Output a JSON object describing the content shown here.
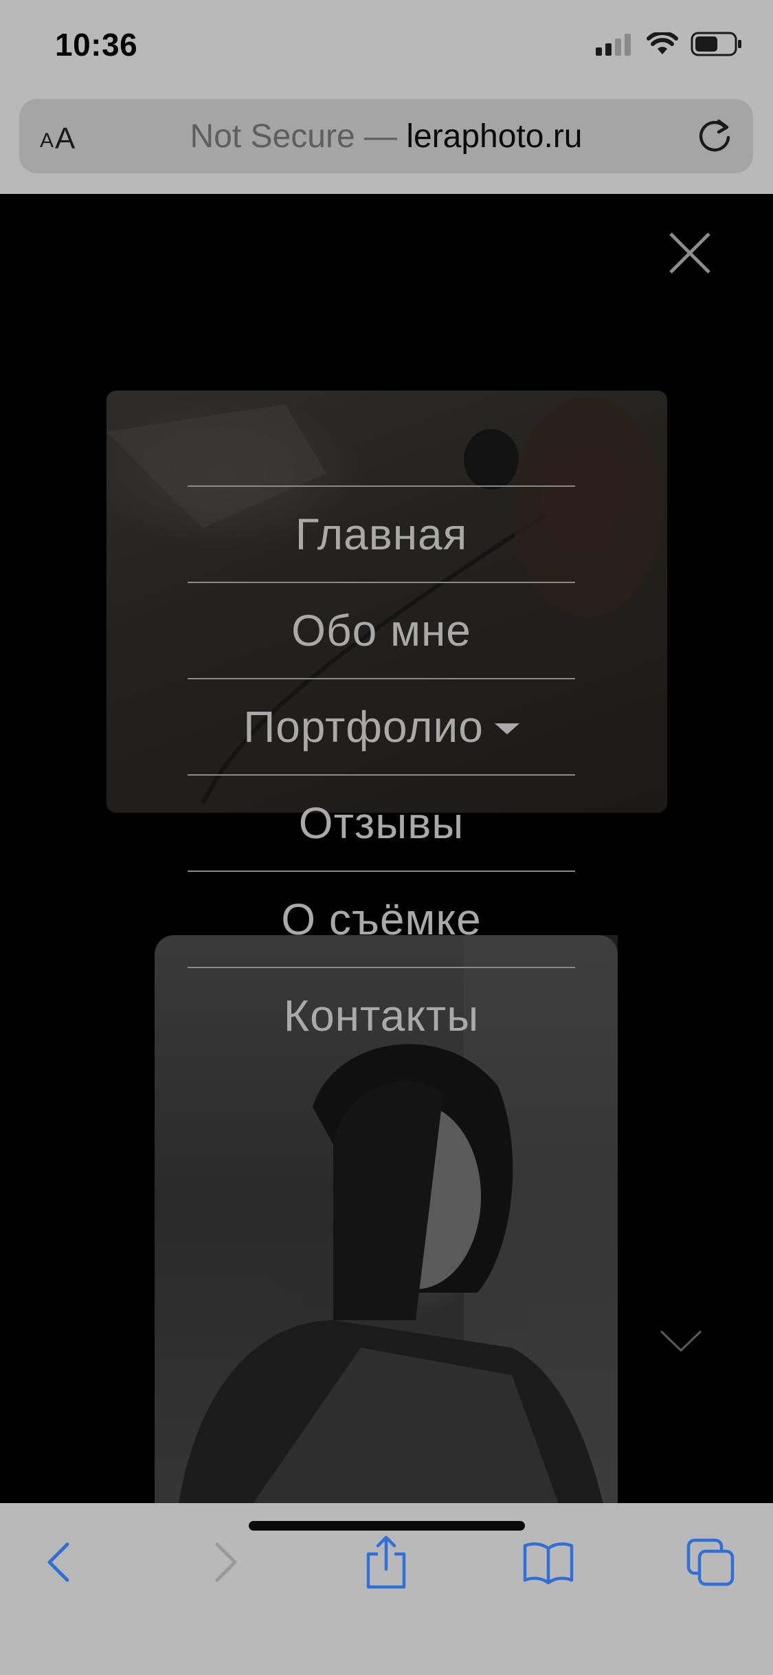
{
  "status_bar": {
    "time": "10:36",
    "icons": [
      "cellular-signal-icon",
      "wifi-icon",
      "battery-icon"
    ],
    "battery_level": 0.6
  },
  "address_bar": {
    "text_size_small": "A",
    "text_size_big": "A",
    "security_label": "Not Secure — ",
    "domain": "leraphoto.ru",
    "reload_icon": "reload-icon"
  },
  "page": {
    "close_icon": "close-icon",
    "scroll_icon": "chevron-down-icon",
    "menu": [
      {
        "label": "Главная"
      },
      {
        "label": "Обо мне"
      },
      {
        "label": "Портфолио",
        "has_submenu": true
      },
      {
        "label": "Отзывы"
      },
      {
        "label": "О съёмке"
      },
      {
        "label": "Контакты"
      }
    ]
  },
  "toolbar": {
    "buttons": [
      "back-icon",
      "forward-icon",
      "share-icon",
      "bookmarks-icon",
      "tabs-icon"
    ],
    "accent_color": "#2f6fd6",
    "disabled_color": "#9a9a9a"
  }
}
